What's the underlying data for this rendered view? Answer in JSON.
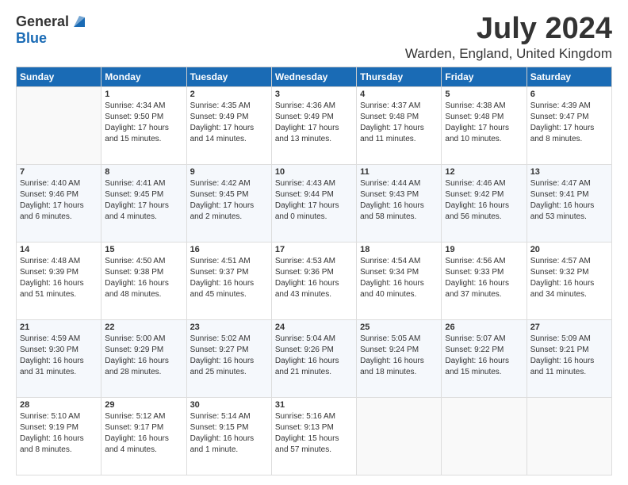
{
  "logo": {
    "general": "General",
    "blue": "Blue"
  },
  "title": "July 2024",
  "subtitle": "Warden, England, United Kingdom",
  "days": [
    "Sunday",
    "Monday",
    "Tuesday",
    "Wednesday",
    "Thursday",
    "Friday",
    "Saturday"
  ],
  "weeks": [
    [
      {
        "day": "",
        "sunrise": "",
        "sunset": "",
        "daylight": ""
      },
      {
        "day": "1",
        "sunrise": "Sunrise: 4:34 AM",
        "sunset": "Sunset: 9:50 PM",
        "daylight": "Daylight: 17 hours and 15 minutes."
      },
      {
        "day": "2",
        "sunrise": "Sunrise: 4:35 AM",
        "sunset": "Sunset: 9:49 PM",
        "daylight": "Daylight: 17 hours and 14 minutes."
      },
      {
        "day": "3",
        "sunrise": "Sunrise: 4:36 AM",
        "sunset": "Sunset: 9:49 PM",
        "daylight": "Daylight: 17 hours and 13 minutes."
      },
      {
        "day": "4",
        "sunrise": "Sunrise: 4:37 AM",
        "sunset": "Sunset: 9:48 PM",
        "daylight": "Daylight: 17 hours and 11 minutes."
      },
      {
        "day": "5",
        "sunrise": "Sunrise: 4:38 AM",
        "sunset": "Sunset: 9:48 PM",
        "daylight": "Daylight: 17 hours and 10 minutes."
      },
      {
        "day": "6",
        "sunrise": "Sunrise: 4:39 AM",
        "sunset": "Sunset: 9:47 PM",
        "daylight": "Daylight: 17 hours and 8 minutes."
      }
    ],
    [
      {
        "day": "7",
        "sunrise": "Sunrise: 4:40 AM",
        "sunset": "Sunset: 9:46 PM",
        "daylight": "Daylight: 17 hours and 6 minutes."
      },
      {
        "day": "8",
        "sunrise": "Sunrise: 4:41 AM",
        "sunset": "Sunset: 9:45 PM",
        "daylight": "Daylight: 17 hours and 4 minutes."
      },
      {
        "day": "9",
        "sunrise": "Sunrise: 4:42 AM",
        "sunset": "Sunset: 9:45 PM",
        "daylight": "Daylight: 17 hours and 2 minutes."
      },
      {
        "day": "10",
        "sunrise": "Sunrise: 4:43 AM",
        "sunset": "Sunset: 9:44 PM",
        "daylight": "Daylight: 17 hours and 0 minutes."
      },
      {
        "day": "11",
        "sunrise": "Sunrise: 4:44 AM",
        "sunset": "Sunset: 9:43 PM",
        "daylight": "Daylight: 16 hours and 58 minutes."
      },
      {
        "day": "12",
        "sunrise": "Sunrise: 4:46 AM",
        "sunset": "Sunset: 9:42 PM",
        "daylight": "Daylight: 16 hours and 56 minutes."
      },
      {
        "day": "13",
        "sunrise": "Sunrise: 4:47 AM",
        "sunset": "Sunset: 9:41 PM",
        "daylight": "Daylight: 16 hours and 53 minutes."
      }
    ],
    [
      {
        "day": "14",
        "sunrise": "Sunrise: 4:48 AM",
        "sunset": "Sunset: 9:39 PM",
        "daylight": "Daylight: 16 hours and 51 minutes."
      },
      {
        "day": "15",
        "sunrise": "Sunrise: 4:50 AM",
        "sunset": "Sunset: 9:38 PM",
        "daylight": "Daylight: 16 hours and 48 minutes."
      },
      {
        "day": "16",
        "sunrise": "Sunrise: 4:51 AM",
        "sunset": "Sunset: 9:37 PM",
        "daylight": "Daylight: 16 hours and 45 minutes."
      },
      {
        "day": "17",
        "sunrise": "Sunrise: 4:53 AM",
        "sunset": "Sunset: 9:36 PM",
        "daylight": "Daylight: 16 hours and 43 minutes."
      },
      {
        "day": "18",
        "sunrise": "Sunrise: 4:54 AM",
        "sunset": "Sunset: 9:34 PM",
        "daylight": "Daylight: 16 hours and 40 minutes."
      },
      {
        "day": "19",
        "sunrise": "Sunrise: 4:56 AM",
        "sunset": "Sunset: 9:33 PM",
        "daylight": "Daylight: 16 hours and 37 minutes."
      },
      {
        "day": "20",
        "sunrise": "Sunrise: 4:57 AM",
        "sunset": "Sunset: 9:32 PM",
        "daylight": "Daylight: 16 hours and 34 minutes."
      }
    ],
    [
      {
        "day": "21",
        "sunrise": "Sunrise: 4:59 AM",
        "sunset": "Sunset: 9:30 PM",
        "daylight": "Daylight: 16 hours and 31 minutes."
      },
      {
        "day": "22",
        "sunrise": "Sunrise: 5:00 AM",
        "sunset": "Sunset: 9:29 PM",
        "daylight": "Daylight: 16 hours and 28 minutes."
      },
      {
        "day": "23",
        "sunrise": "Sunrise: 5:02 AM",
        "sunset": "Sunset: 9:27 PM",
        "daylight": "Daylight: 16 hours and 25 minutes."
      },
      {
        "day": "24",
        "sunrise": "Sunrise: 5:04 AM",
        "sunset": "Sunset: 9:26 PM",
        "daylight": "Daylight: 16 hours and 21 minutes."
      },
      {
        "day": "25",
        "sunrise": "Sunrise: 5:05 AM",
        "sunset": "Sunset: 9:24 PM",
        "daylight": "Daylight: 16 hours and 18 minutes."
      },
      {
        "day": "26",
        "sunrise": "Sunrise: 5:07 AM",
        "sunset": "Sunset: 9:22 PM",
        "daylight": "Daylight: 16 hours and 15 minutes."
      },
      {
        "day": "27",
        "sunrise": "Sunrise: 5:09 AM",
        "sunset": "Sunset: 9:21 PM",
        "daylight": "Daylight: 16 hours and 11 minutes."
      }
    ],
    [
      {
        "day": "28",
        "sunrise": "Sunrise: 5:10 AM",
        "sunset": "Sunset: 9:19 PM",
        "daylight": "Daylight: 16 hours and 8 minutes."
      },
      {
        "day": "29",
        "sunrise": "Sunrise: 5:12 AM",
        "sunset": "Sunset: 9:17 PM",
        "daylight": "Daylight: 16 hours and 4 minutes."
      },
      {
        "day": "30",
        "sunrise": "Sunrise: 5:14 AM",
        "sunset": "Sunset: 9:15 PM",
        "daylight": "Daylight: 16 hours and 1 minute."
      },
      {
        "day": "31",
        "sunrise": "Sunrise: 5:16 AM",
        "sunset": "Sunset: 9:13 PM",
        "daylight": "Daylight: 15 hours and 57 minutes."
      },
      {
        "day": "",
        "sunrise": "",
        "sunset": "",
        "daylight": ""
      },
      {
        "day": "",
        "sunrise": "",
        "sunset": "",
        "daylight": ""
      },
      {
        "day": "",
        "sunrise": "",
        "sunset": "",
        "daylight": ""
      }
    ]
  ]
}
